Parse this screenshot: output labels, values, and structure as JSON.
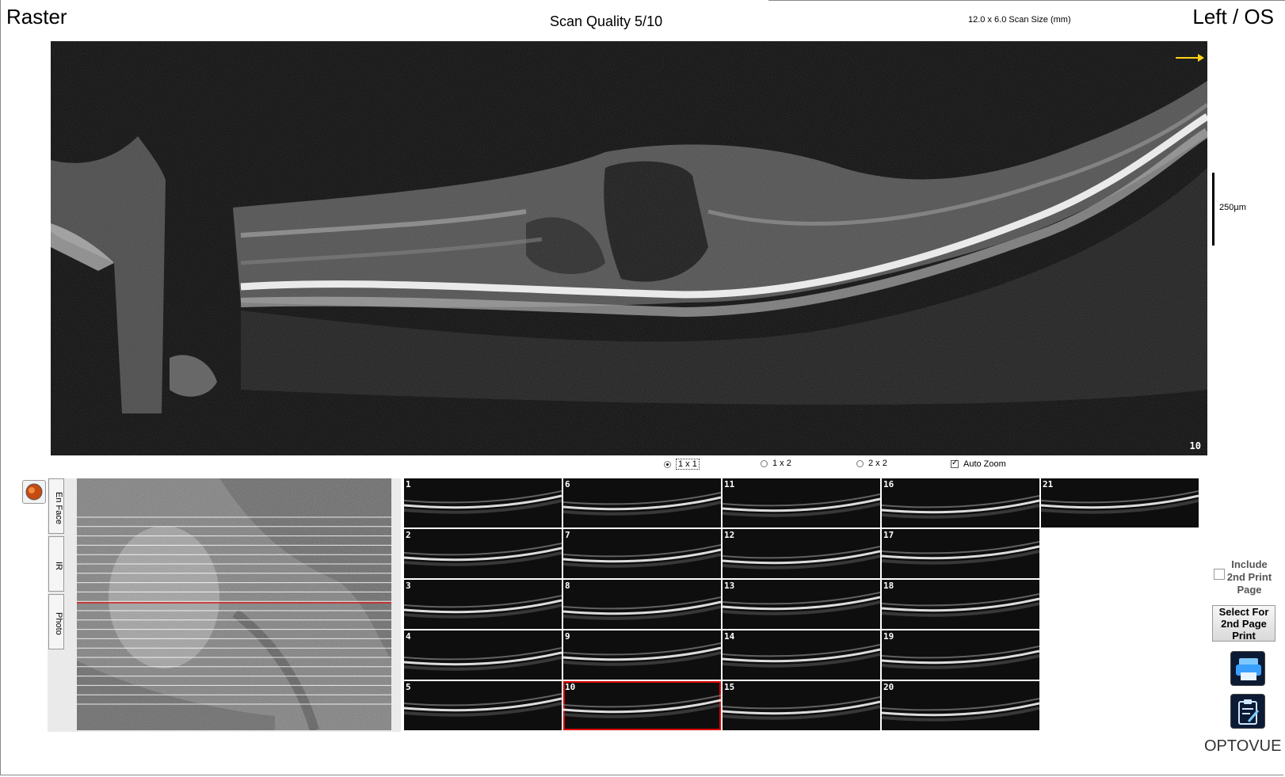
{
  "header": {
    "mode": "Raster",
    "scan_quality": "Scan Quality 5/10",
    "scan_size": "12.0 x 6.0 Scan Size (mm)",
    "eye": "Left / OS"
  },
  "main_scan": {
    "frame_number": "10",
    "scale_label": "250µm"
  },
  "layout_options": {
    "opt_1x1": "1 x 1",
    "opt_1x2": "1 x 2",
    "opt_2x2": "2 x 2",
    "selected": "1 x 1",
    "auto_zoom_label": "Auto Zoom",
    "auto_zoom_checked": true
  },
  "side_tabs": [
    "En Face",
    "IR",
    "Photo"
  ],
  "thumbnails": {
    "columns": [
      [
        "1",
        "2",
        "3",
        "4",
        "5"
      ],
      [
        "6",
        "7",
        "8",
        "9",
        "10"
      ],
      [
        "11",
        "12",
        "13",
        "14",
        "15"
      ],
      [
        "16",
        "17",
        "18",
        "19",
        "20"
      ],
      [
        "21"
      ]
    ],
    "selected": "10"
  },
  "right_panel": {
    "include_label": "Include 2nd Print Page",
    "select_button": "Select For 2nd Page Print",
    "print_icon": "printer-icon",
    "report_icon": "clipboard-icon"
  },
  "brand": {
    "logo_text": "OPTOVUE",
    "accent": "#e07b1a",
    "selection_color": "#dd0000"
  }
}
